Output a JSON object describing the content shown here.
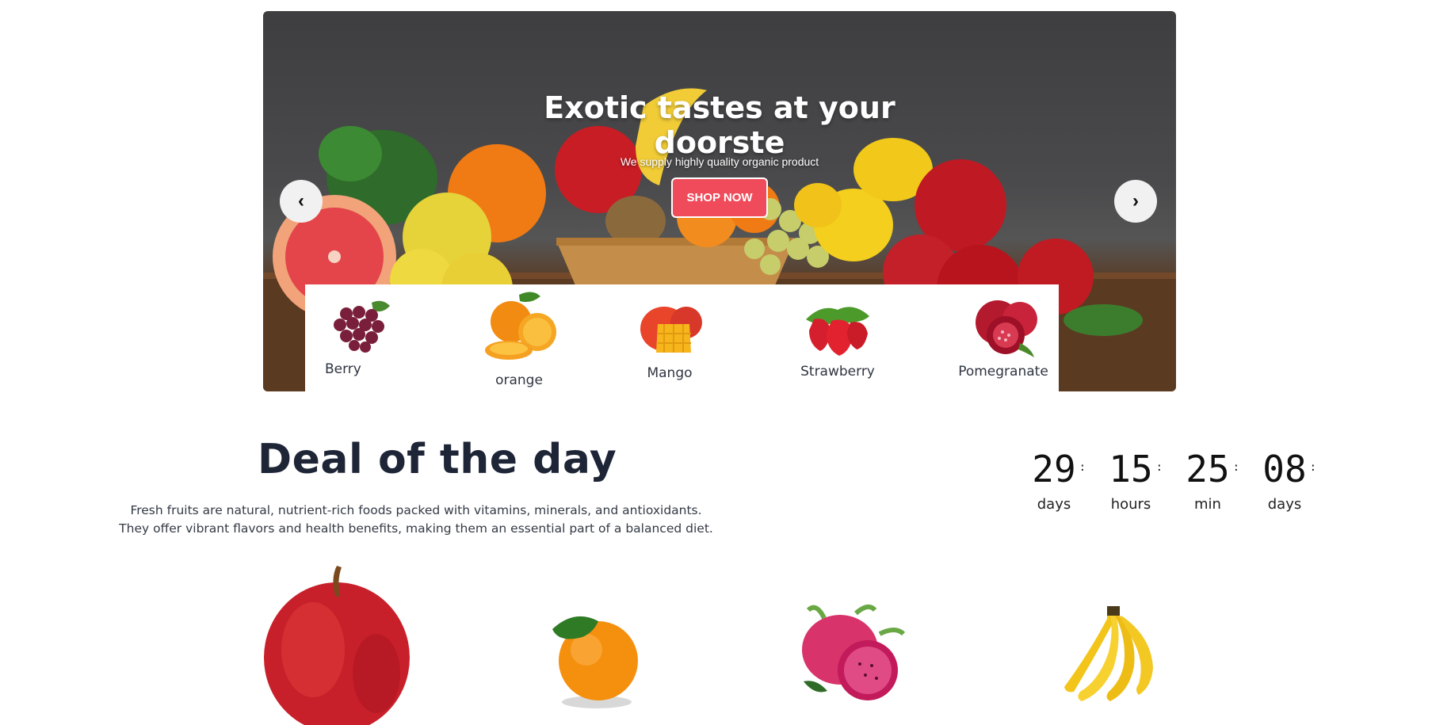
{
  "hero": {
    "title": "Exotic tastes at your doorste",
    "subtitle": "We supply highly quality organic product",
    "cta_label": "SHOP NOW",
    "prev_label": "‹",
    "next_label": "›",
    "accent_color": "#ef4b5a"
  },
  "categories": [
    {
      "label": "Berry",
      "icon": "grapes-icon"
    },
    {
      "label": "orange",
      "icon": "orange-icon"
    },
    {
      "label": "Mango",
      "icon": "mango-icon"
    },
    {
      "label": "Strawberry",
      "icon": "strawberry-icon"
    },
    {
      "label": "Pomegranate",
      "icon": "pomegranate-icon"
    }
  ],
  "deal": {
    "title": "Deal of the day",
    "description_line1": "Fresh fruits are natural, nutrient-rich foods packed with vitamins, minerals, and antioxidants.",
    "description_line2": "They offer vibrant flavors and health benefits, making them an essential part of a balanced diet."
  },
  "countdown": [
    {
      "value": "29",
      "label": "days"
    },
    {
      "value": "15",
      "label": "hours"
    },
    {
      "value": "25",
      "label": "min"
    },
    {
      "value": "08",
      "label": "days"
    }
  ],
  "countdown_separator": ":",
  "products": [
    {
      "icon": "apple-icon"
    },
    {
      "icon": "orange-icon"
    },
    {
      "icon": "dragon-fruit-icon"
    },
    {
      "icon": "banana-icon"
    }
  ]
}
